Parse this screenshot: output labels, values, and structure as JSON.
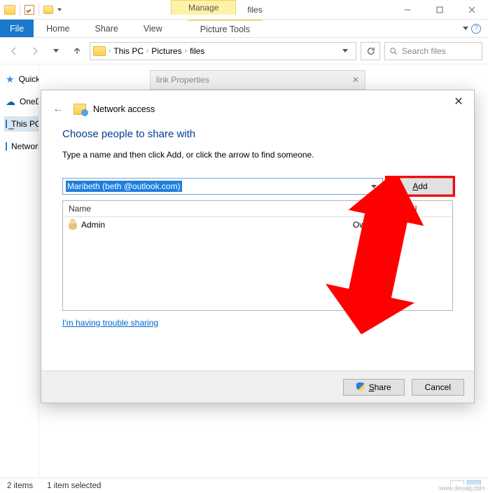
{
  "window": {
    "title": "files",
    "context_tab_group": "Manage"
  },
  "ribbon": {
    "file": "File",
    "home": "Home",
    "share": "Share",
    "view": "View",
    "context": "Picture Tools"
  },
  "breadcrumb": {
    "root": "This PC",
    "p1": "Pictures",
    "p2": "files"
  },
  "search": {
    "placeholder": "Search files"
  },
  "sidebar": {
    "quick": "Quick access",
    "onedrive": "OneDrive",
    "thispc": "This PC",
    "network": "Network"
  },
  "peek_dialog": {
    "title": "link Properties"
  },
  "status": {
    "count": "2 items",
    "selected": "1 item selected"
  },
  "modal": {
    "wizard_title": "Network access",
    "heading": "Choose people to share with",
    "hint": "Type a name and then click Add, or click the arrow to find someone.",
    "combo_value": "Maribeth          (beth         @outlook.com)",
    "add": "Add",
    "col_name": "Name",
    "col_perm": "Permission Level",
    "rows": [
      {
        "name": "Admin",
        "perm": "Owner"
      }
    ],
    "trouble": "I'm having trouble sharing",
    "share": "Share",
    "cancel": "Cancel"
  },
  "watermark": "www.deuaq.com"
}
